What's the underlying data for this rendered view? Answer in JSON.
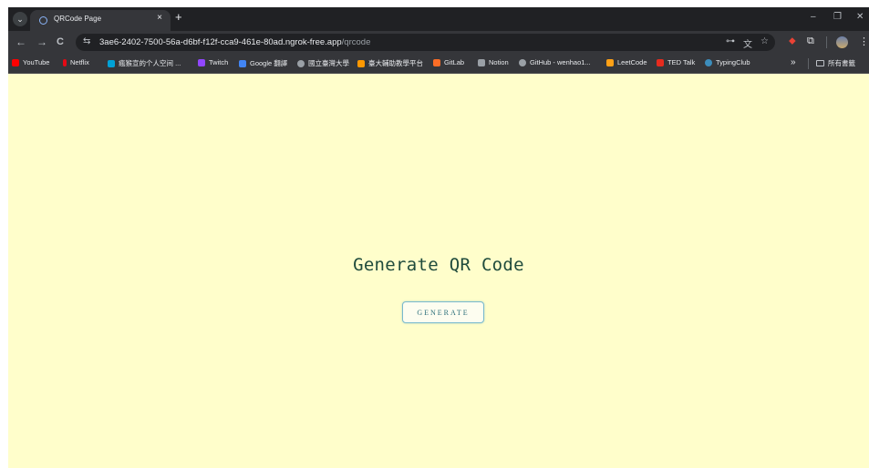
{
  "tab": {
    "title": "QRCode Page",
    "close": "×",
    "new_tab": "+"
  },
  "window_controls": {
    "minimize": "–",
    "restore": "❐",
    "close": "✕"
  },
  "toolbar": {
    "back": "←",
    "forward": "→",
    "reload": "C",
    "site_info_icon": "⇆",
    "url_host": "3ae6-2402-7500-56a-d6bf-f12f-cca9-461e-80ad.ngrok-free.app",
    "url_path": "/qrcode",
    "password_key_icon": "⊶",
    "translate_icon": "文",
    "star_icon": "☆",
    "extensions_icon": "⧉",
    "menu_icon": "⋮"
  },
  "bookmarks": [
    {
      "label": "YouTube",
      "color": "#ff0000"
    },
    {
      "label": "Netflix",
      "color": "#e50914"
    },
    {
      "label": "瘋猴宣的个人空间 ...",
      "color": "#00a1d6"
    },
    {
      "label": "Twitch",
      "color": "#9146ff"
    },
    {
      "label": "Google 翻譯",
      "color": "#4285f4"
    },
    {
      "label": "國立臺灣大學",
      "color": "#9aa0a6"
    },
    {
      "label": "臺大輔助教學平台",
      "color": "#ff9800"
    },
    {
      "label": "GitLab",
      "color": "#fc6d26"
    },
    {
      "label": "Notion",
      "color": "#9aa0a6"
    },
    {
      "label": "GitHub - wenhao1...",
      "color": "#9aa0a6"
    },
    {
      "label": "LeetCode",
      "color": "#ffa116"
    },
    {
      "label": "TED Talk",
      "color": "#e62b1e"
    },
    {
      "label": "TypingClub",
      "color": "#3c8dbc"
    }
  ],
  "bookmarks_more": "»",
  "all_bookmarks_label": "所有書籤",
  "page": {
    "title": "Generate QR Code",
    "button_label": "GENERATE"
  }
}
